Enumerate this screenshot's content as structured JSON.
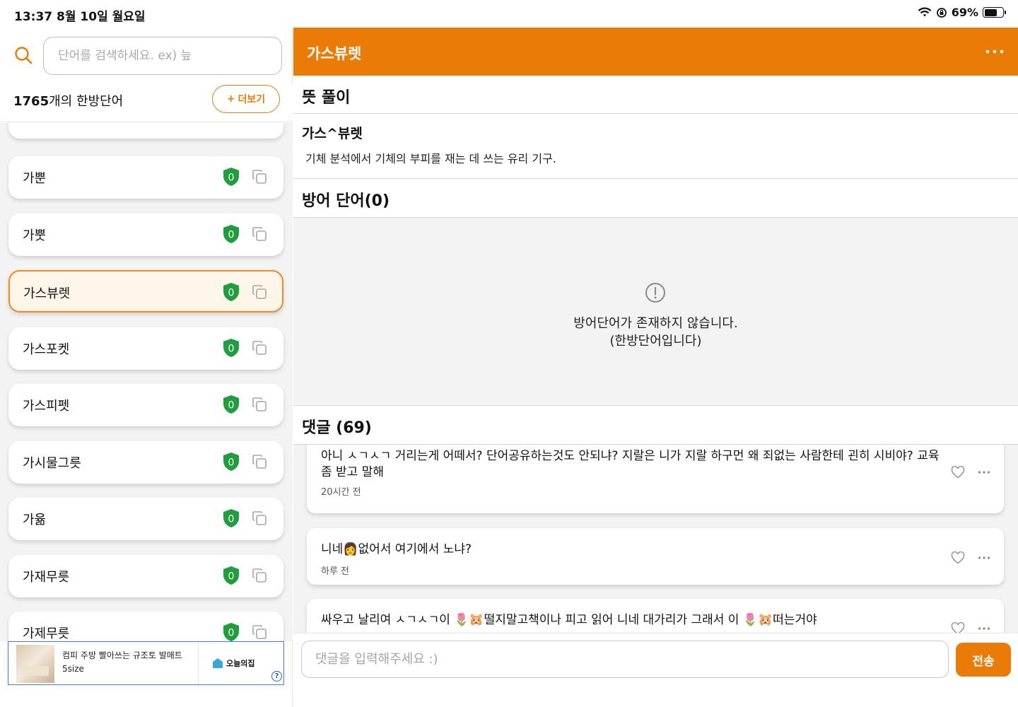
{
  "status_bar": {
    "time_date": "13:37  8월 10일 월요일",
    "battery": "69%",
    "battery_level": 0.69
  },
  "search": {
    "placeholder": "단어를 검색하세요. ex) 늪"
  },
  "word_count": {
    "number": "1765",
    "suffix": "개의 한방단어"
  },
  "more_button": {
    "icon": "+",
    "label": "더보기"
  },
  "word_list": [
    {
      "word": "가뿐",
      "badge": "0"
    },
    {
      "word": "가뿟",
      "badge": "0"
    },
    {
      "word": "가스뷰렛",
      "badge": "0",
      "selected": true
    },
    {
      "word": "가스포켓",
      "badge": "0"
    },
    {
      "word": "가스피펫",
      "badge": "0"
    },
    {
      "word": "가시물그릇",
      "badge": "0"
    },
    {
      "word": "가윪",
      "badge": "0"
    },
    {
      "word": "가재무릇",
      "badge": "0"
    },
    {
      "word": "가제무릇",
      "badge": "0"
    }
  ],
  "ad": {
    "title": "컴피 주방 빨아쓰는 규조토 발매트",
    "subtitle": "5size",
    "brand": "오늘의집",
    "help": "?"
  },
  "detail": {
    "title": "가스뷰렛",
    "meaning_header": "뜻 풀이",
    "word_display": "가스^뷰렛",
    "definition": "기체 분석에서 기체의 부피를 재는 데 쓰는 유리 기구.",
    "defense_header": "방어 단어(0)",
    "defense_empty_line1": "방어단어가 존재하지 않습니다.",
    "defense_empty_line2": "(한방단어입니다)",
    "comments_header": "댓글 (69)"
  },
  "comments": [
    {
      "text": "아니 ㅅㄱㅅㄱ 거리는게 어떼서? 단어공유하는것도 안되냐? 지랄은 니가 지랄 하구먼 왜 죄없는 사람한테 괸히 시비야? 교육좀 받고 말해",
      "time": "20시간 전"
    },
    {
      "text": "니네👩없어서 여기에서 노냐?",
      "time": "하루 전"
    },
    {
      "text": "싸우고 날리여 ㅅㄱㅅㄱ이 🌷🐹떨지말고책이나 피고 읽어 니네 대가리가 그래서 이 🌷🐹떠는거야",
      "time": ""
    }
  ],
  "comment_input": {
    "placeholder": "댓글을 입력해주세요 :)"
  },
  "send_button": {
    "label": "전송"
  },
  "colors": {
    "accent": "#ea7b07",
    "shield": "#1f9d3f",
    "ad_border": "#3a7fe0"
  }
}
